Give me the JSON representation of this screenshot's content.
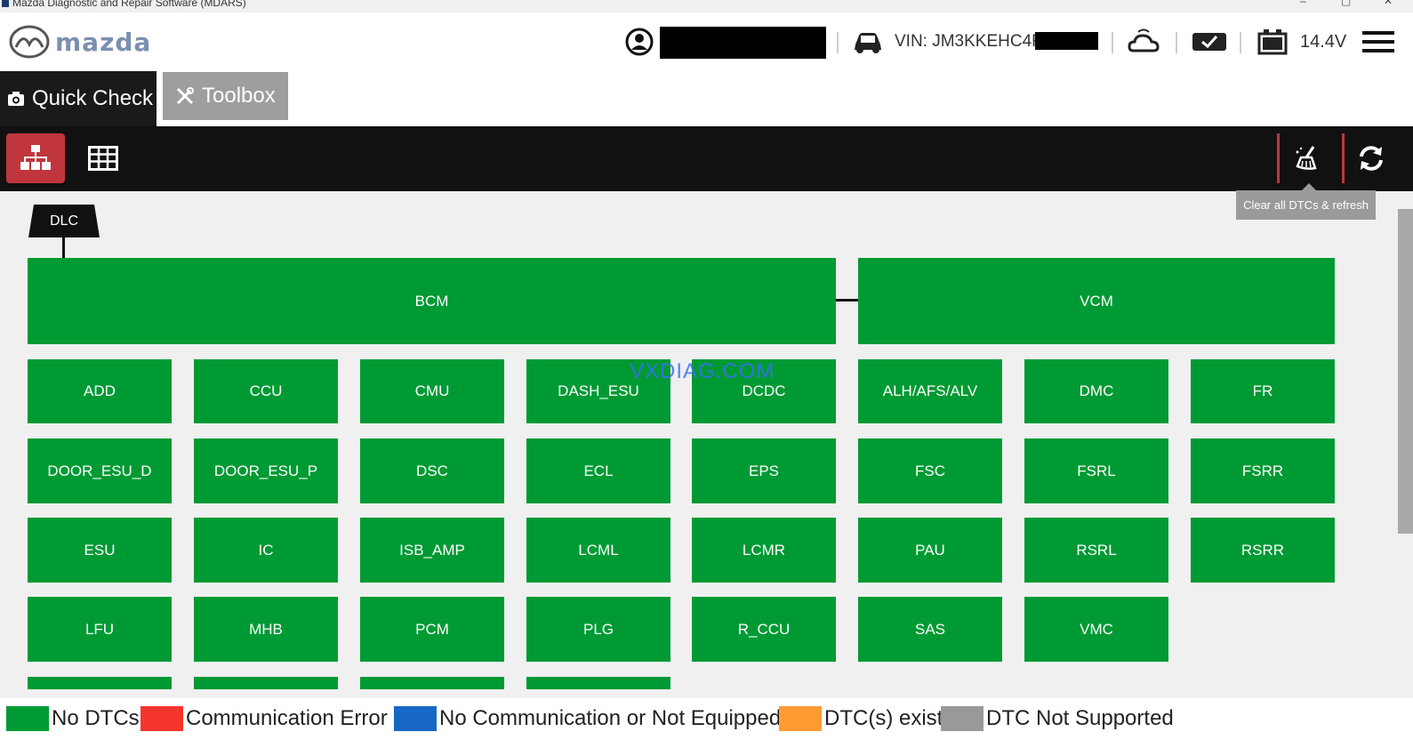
{
  "window": {
    "title": "Mazda Diagnostic and Repair Software (MDARS)"
  },
  "header": {
    "brand": "mazda",
    "vin_label": "VIN: JM3KKEHC4R",
    "voltage": "14.4V"
  },
  "tabs": [
    {
      "label": "Quick Check"
    },
    {
      "label": "Toolbox"
    }
  ],
  "toolbar": {
    "tooltip": "Clear all DTCs & refresh"
  },
  "topology": {
    "dlc_label": "DLC",
    "bus_modules": [
      "BCM",
      "VCM"
    ],
    "modules_row1": [
      "ADD",
      "CCU",
      "CMU",
      "DASH_ESU",
      "DCDC",
      "ALH/AFS/ALV",
      "DMC",
      "FR"
    ],
    "modules_row2": [
      "DOOR_ESU_D",
      "DOOR_ESU_P",
      "DSC",
      "ECL",
      "EPS",
      "FSC",
      "FSRL",
      "FSRR"
    ],
    "modules_row3": [
      "ESU",
      "IC",
      "ISB_AMP",
      "LCML",
      "LCMR",
      "PAU",
      "RSRL",
      "RSRR"
    ],
    "modules_row4": [
      "LFU",
      "MHB",
      "PCM",
      "PLG",
      "R_CCU",
      "SAS",
      "VMC"
    ]
  },
  "watermark": "VXDIAG.COM",
  "legend": [
    {
      "label": "No DTCs",
      "color": "#009a34"
    },
    {
      "label": "Communication Error",
      "color": "#f5352b"
    },
    {
      "label": "No Communication or Not Equipped",
      "color": "#1767c4"
    },
    {
      "label": "DTC(s) exist",
      "color": "#ff9b33"
    },
    {
      "label": "DTC Not Supported",
      "color": "#999999"
    }
  ],
  "colors": {
    "module_ok": "#009a34",
    "accent_red": "#c0363c",
    "toolbar_bg": "#111111"
  }
}
